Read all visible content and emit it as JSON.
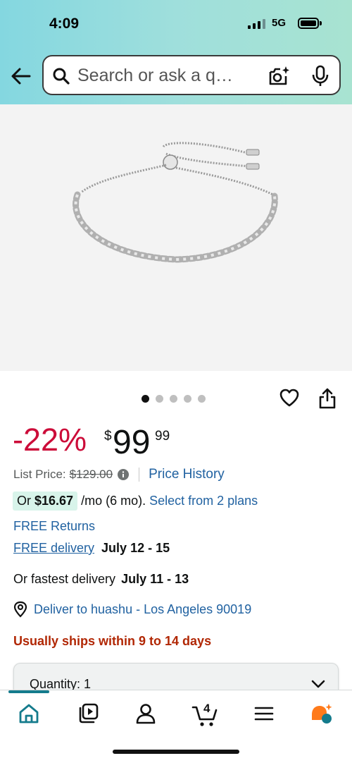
{
  "status_bar": {
    "time": "4:09",
    "network": "5G"
  },
  "search": {
    "placeholder": "Search or ask a q…"
  },
  "product": {
    "image_dots_count": 5,
    "active_dot": 0
  },
  "pricing": {
    "discount": "-22%",
    "currency": "$",
    "price_whole": "99",
    "price_fraction": "99",
    "list_price_label": "List Price:",
    "list_price": "$129.00",
    "price_history_label": "Price History"
  },
  "installments": {
    "prefix": "Or",
    "amount": "$16.67",
    "term": "/mo (6 mo).",
    "link": "Select from 2 plans"
  },
  "returns": "FREE Returns",
  "delivery": {
    "free_delivery_label": "FREE delivery",
    "free_delivery_dates": "July 12 - 15",
    "fastest_prefix": "Or fastest delivery",
    "fastest_dates": "July 11 - 13",
    "deliver_to": "Deliver to huashu - Los Angeles 90019"
  },
  "shipping_note": "Usually ships within 9 to 14 days",
  "quantity": {
    "label": "Quantity: 1"
  },
  "bottom_nav": {
    "items": [
      "home-icon",
      "video-icon",
      "account-icon",
      "cart-icon",
      "menu-icon",
      "rufus-icon"
    ],
    "cart_count": "4"
  },
  "colors": {
    "accent": "#147b8c",
    "discount": "#cc0c39",
    "link": "#2162a1",
    "warning": "#b12704"
  }
}
